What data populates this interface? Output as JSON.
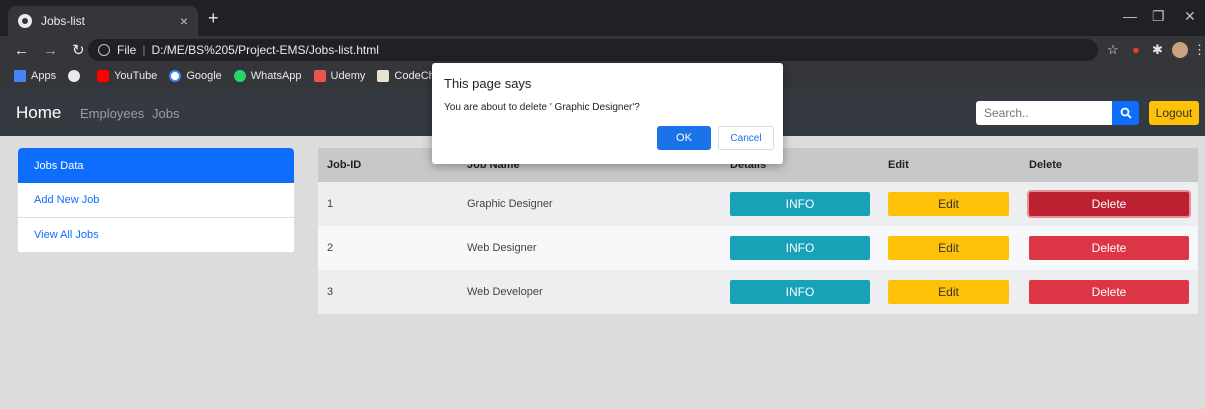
{
  "browser": {
    "tab_title": "Jobs-list",
    "tab_close": "×",
    "new_tab": "+",
    "url_scheme": "File",
    "url": "D:/ME/BS%205/Project-EMS/Jobs-list.html",
    "bookmarks": [
      "Apps",
      "YouTube",
      "Google",
      "WhatsApp",
      "Udemy",
      "CodeChef"
    ]
  },
  "navbar": {
    "brand": "Home",
    "links": [
      "Employees",
      "Jobs"
    ],
    "search_placeholder": "Search..",
    "logout_label": "Logout"
  },
  "sidebar": {
    "items": [
      "Jobs Data",
      "Add New Job",
      "View All Jobs"
    ]
  },
  "table": {
    "headers": [
      "Job-ID",
      "Job Name",
      "Details",
      "Edit",
      "Delete"
    ],
    "rows": [
      {
        "id": "1",
        "name": "Graphic Designer",
        "info": "INFO",
        "edit": "Edit",
        "delete": "Delete"
      },
      {
        "id": "2",
        "name": "Web Designer",
        "info": "INFO",
        "edit": "Edit",
        "delete": "Delete"
      },
      {
        "id": "3",
        "name": "Web Developer",
        "info": "INFO",
        "edit": "Edit",
        "delete": "Delete"
      }
    ]
  },
  "dialog": {
    "title": "This page says",
    "message": "You are about to delete ' Graphic Designer'?",
    "ok": "OK",
    "cancel": "Cancel"
  },
  "colors": {
    "primary": "#0d6efd",
    "info": "#17a2b8",
    "warning": "#ffc107",
    "danger": "#dc3545",
    "navbar": "#343a40"
  }
}
